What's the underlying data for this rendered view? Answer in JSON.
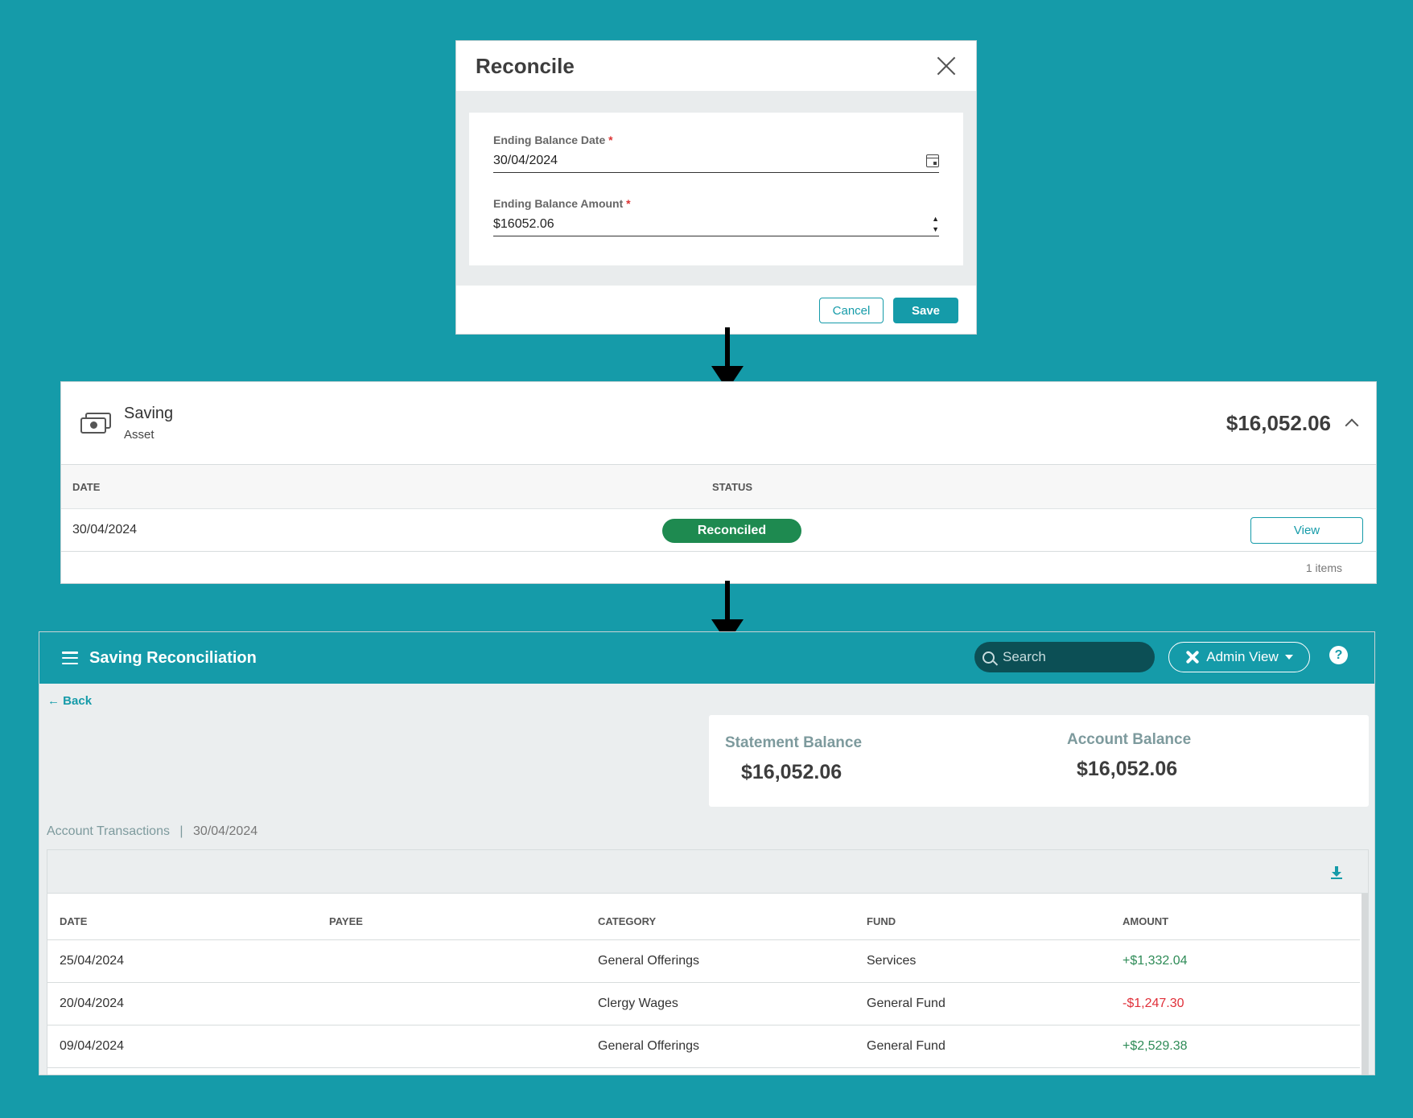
{
  "dialog": {
    "title": "Reconcile",
    "fields": [
      {
        "label": "Ending Balance Date",
        "required_mark": "*",
        "value": "30/04/2024",
        "icon": "calendar-icon"
      },
      {
        "label": "Ending Balance Amount",
        "required_mark": "*",
        "value": "$16052.06",
        "icon": "stepper"
      }
    ],
    "cancel_label": "Cancel",
    "save_label": "Save"
  },
  "account": {
    "icon": "money-icon",
    "name": "Saving",
    "type": "Asset",
    "balance": "$16,052.06",
    "columns": {
      "date": "DATE",
      "status": "STATUS"
    },
    "rows": [
      {
        "date": "30/04/2024",
        "status": "Reconciled",
        "action": "View"
      }
    ],
    "footer": "1 items"
  },
  "page": {
    "title": "Saving Reconciliation",
    "search_placeholder": "Search",
    "admin_label": "Admin View",
    "help_label": "?",
    "back_label": "Back",
    "statement_balance_label": "Statement Balance",
    "statement_balance": "$16,052.06",
    "account_balance_label": "Account Balance",
    "account_balance": "$16,052.06",
    "transactions_label": "Account Transactions",
    "separator": "|",
    "transactions_date": "30/04/2024",
    "columns": {
      "date": "DATE",
      "payee": "PAYEE",
      "category": "CATEGORY",
      "fund": "FUND",
      "amount": "AMOUNT"
    },
    "transactions": [
      {
        "date": "25/04/2024",
        "payee": "",
        "category": "General Offerings",
        "fund": "Services",
        "amount": "+$1,332.04"
      },
      {
        "date": "20/04/2024",
        "payee": "",
        "category": "Clergy Wages",
        "fund": "General Fund",
        "amount": "-$1,247.30"
      },
      {
        "date": "09/04/2024",
        "payee": "",
        "category": "General Offerings",
        "fund": "General Fund",
        "amount": "+$2,529.38"
      }
    ],
    "colors": {
      "accent": "#159ba9",
      "positive": "#2e8b57",
      "negative": "#e0303a",
      "reconciled": "#1e8a50"
    }
  }
}
